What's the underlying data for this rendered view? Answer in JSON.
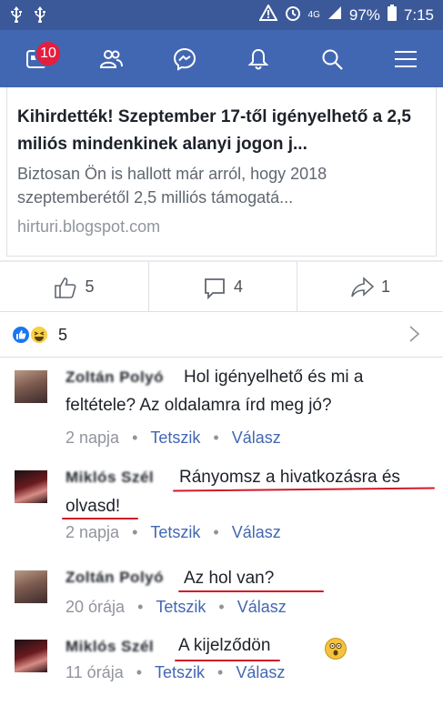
{
  "status_bar": {
    "network": "4G",
    "battery": "97%",
    "time": "7:15"
  },
  "nav": {
    "notification_count": "10"
  },
  "link_card": {
    "title": "Kihirdették! Szeptember 17-től igényelhető a 2,5 miliós mindenkinek alanyi jogon j...",
    "description": "Biztosan Ön is hallott már arról, hogy 2018 szeptemberétől 2,5 milliós támogatá...",
    "domain": "hirturi.blogspot.com"
  },
  "actions": {
    "likes": "5",
    "comments": "4",
    "shares": "1"
  },
  "reactions": {
    "count": "5"
  },
  "comments": [
    {
      "name": "Zoltán Polyó",
      "text_line1": "Hol igényelhető és mi a",
      "text_line2": "feltétele? Az oldalamra írd meg jó?",
      "time": "2 napja",
      "like_label": "Tetszik",
      "reply_label": "Válasz"
    },
    {
      "name": "Miklós Szél",
      "text_line1": "Rányomsz a hivatkozásra és",
      "text_line2": "olvasd!",
      "time": "2 napja",
      "like_label": "Tetszik",
      "reply_label": "Válasz"
    },
    {
      "name": "Zoltán Polyó",
      "text_line1": "Az hol van?",
      "time": "20 órája",
      "like_label": "Tetszik",
      "reply_label": "Válasz"
    },
    {
      "name": "Miklós Szél",
      "text_line1": "A kijelződön",
      "time": "11 órája",
      "like_label": "Tetszik",
      "reply_label": "Válasz"
    }
  ],
  "separator": "•",
  "icons": {
    "status": [
      "usb-icon",
      "warning-icon",
      "alarm-icon",
      "signal-icon",
      "battery-icon"
    ],
    "nav": [
      "news-feed-icon",
      "friends-icon",
      "messenger-icon",
      "bell-icon",
      "search-icon",
      "menu-icon"
    ]
  },
  "colors": {
    "brand": "#4267b2",
    "status_bar": "#3b5998",
    "badge": "#e41e3f",
    "link": "#4267b2",
    "underline": "#d11a2a"
  }
}
